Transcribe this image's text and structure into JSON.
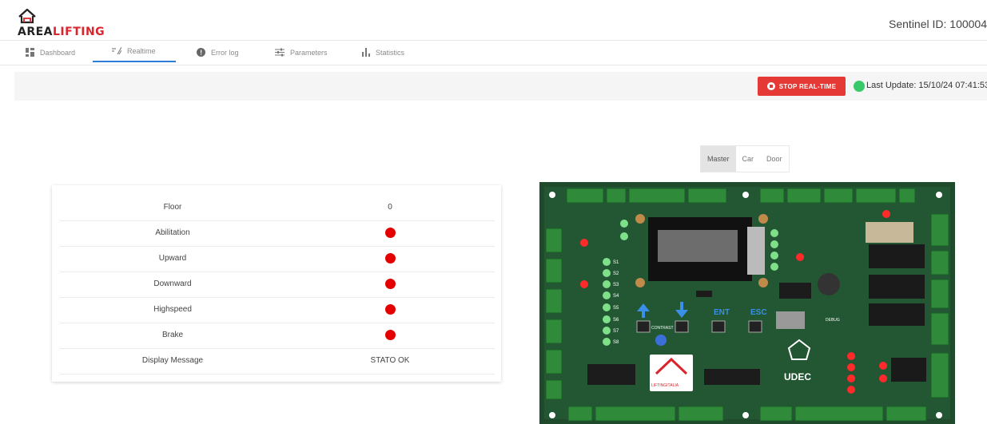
{
  "header": {
    "brand_prefix": "AREA",
    "brand_suffix": "LIFTING",
    "sentinel_id": "Sentinel ID: 100004"
  },
  "tabs": [
    {
      "label": "Dashboard",
      "icon": "dashboard-icon",
      "active": false
    },
    {
      "label": "Realtime",
      "icon": "realtime-icon",
      "active": true
    },
    {
      "label": "Error log",
      "icon": "error-icon",
      "active": false
    },
    {
      "label": "Parameters",
      "icon": "parameters-icon",
      "active": false
    },
    {
      "label": "Statistics",
      "icon": "statistics-icon",
      "active": false
    }
  ],
  "toolbar": {
    "stop_label": "STOP REAL-TIME",
    "last_update": "Last Update: 15/10/24 07:41:53",
    "status_color": "#39c96a",
    "stop_color": "#e53935"
  },
  "board_selector": {
    "options": [
      "Master",
      "Car",
      "Door"
    ],
    "selected": "Master"
  },
  "status_table": {
    "rows": [
      {
        "label": "Floor",
        "value": "0",
        "type": "text"
      },
      {
        "label": "Abilitation",
        "value": "",
        "type": "indicator",
        "color": "#e50000"
      },
      {
        "label": "Upward",
        "value": "",
        "type": "indicator",
        "color": "#e50000"
      },
      {
        "label": "Downward",
        "value": "",
        "type": "indicator",
        "color": "#e50000"
      },
      {
        "label": "Highspeed",
        "value": "",
        "type": "indicator",
        "color": "#e50000"
      },
      {
        "label": "Brake",
        "value": "",
        "type": "indicator",
        "color": "#e50000"
      },
      {
        "label": "Display Message",
        "value": "STATO OK",
        "type": "text"
      }
    ]
  },
  "board": {
    "keys": [
      "ENT",
      "ESC"
    ],
    "contrast_label": "CONTRAST",
    "debug_label": "DEBUG",
    "logo_left": "LIFTINGITALIA",
    "logo_right": "UDEC",
    "inputs": [
      "S1",
      "S2",
      "S3",
      "S4",
      "S5",
      "S6",
      "S7",
      "S8"
    ]
  }
}
